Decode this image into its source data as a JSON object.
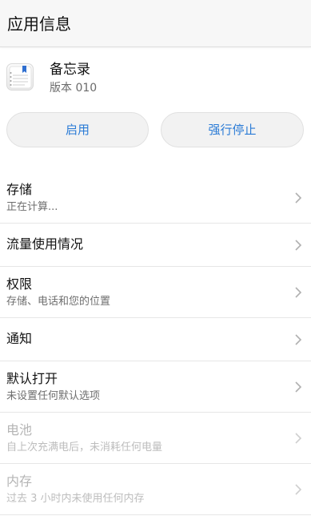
{
  "header": {
    "title": "应用信息"
  },
  "app": {
    "name": "备忘录",
    "version": "版本 010",
    "icon": "notepad-icon"
  },
  "buttons": {
    "enable": "启用",
    "force_stop": "强行停止"
  },
  "settings": [
    {
      "title": "存储",
      "subtitle": "正在计算..."
    },
    {
      "title": "流量使用情况"
    },
    {
      "title": "权限",
      "subtitle": "存储、电话和您的位置"
    },
    {
      "title": "通知"
    },
    {
      "title": "默认打开",
      "subtitle": "未设置任何默认选项"
    },
    {
      "title": "电池",
      "subtitle": "自上次充满电后，未消耗任何电量",
      "disabled": true
    },
    {
      "title": "内存",
      "subtitle": "过去 3 小时内未使用任何内存",
      "disabled": true
    }
  ],
  "colors": {
    "accent": "#2a7bd6",
    "title_bar": "#f7f7f7",
    "divider": "#e6e6e6",
    "disabled_text": "#b5b5b5"
  }
}
